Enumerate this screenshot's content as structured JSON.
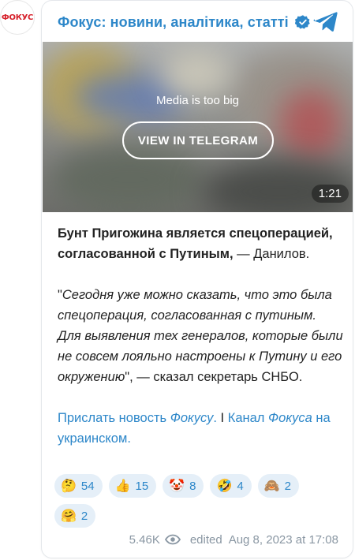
{
  "channel": {
    "avatar_text": "ФОКУС",
    "title": "Фокус: новини, аналітика, статті",
    "accent": "#2d87c9"
  },
  "media": {
    "message": "Media is too big",
    "button": "VIEW IN TELEGRAM",
    "duration": "1:21"
  },
  "post": {
    "headline_bold": "Бунт Пригожина является спецоперацией, согласованной с Путиным,",
    "headline_rest": " — Данилов.",
    "quote_open": "\"",
    "quote_italic": "Сегодня уже можно сказать, что это была спецоперация, согласованная с путиным. Для выявления тех генералов, которые были не совсем лояльно настроены к Путину и его окружению",
    "quote_close": "\", — сказал секретарь СНБО.",
    "link1_a": "Прислать новость ",
    "link1_b": "Фокусу",
    "link1_c": ".",
    "separator": " I ",
    "link2_a": "Канал ",
    "link2_b": "Фокуса",
    "link2_c": " на украинском."
  },
  "reactions": [
    {
      "emoji": "🤔",
      "count": "54"
    },
    {
      "emoji": "👍",
      "count": "15"
    },
    {
      "emoji": "🤡",
      "count": "8"
    },
    {
      "emoji": "🤣",
      "count": "4"
    },
    {
      "emoji": "🙈",
      "count": "2"
    },
    {
      "emoji": "🤗",
      "count": "2"
    }
  ],
  "footer": {
    "views": "5.46K",
    "edited": "edited",
    "date": "Aug 8, 2023 at 17:08"
  }
}
